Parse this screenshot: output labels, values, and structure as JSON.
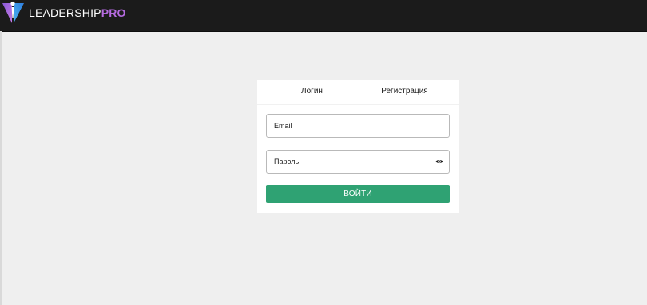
{
  "brand": {
    "name_main": "LEADERSHIP",
    "name_accent": "PRO",
    "logo_icon": "leadershippro-logo-icon",
    "accent_color": "#b56be0"
  },
  "auth": {
    "tabs": [
      {
        "label": "Логин",
        "active": true
      },
      {
        "label": "Регистрация",
        "active": false
      }
    ],
    "email_placeholder": "Email",
    "password_placeholder": "Пароль",
    "password_toggle_icon": "eye-icon",
    "submit_label": "ВОЙТИ",
    "submit_color": "#2fa273",
    "active_tab_color": "#e8c46a"
  }
}
